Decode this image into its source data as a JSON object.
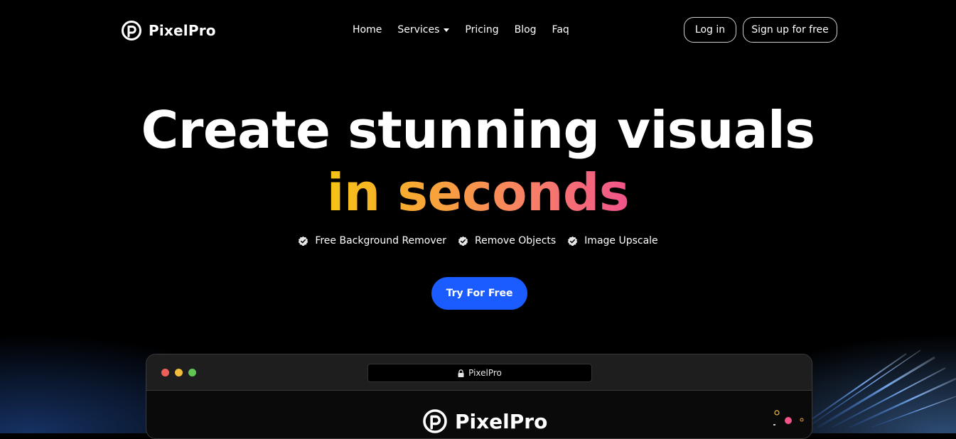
{
  "brand": {
    "name": "PixelPro",
    "logo_icon": "pixelpro-logo-icon"
  },
  "nav": {
    "items": [
      {
        "label": "Home"
      },
      {
        "label": "Services",
        "has_dropdown": true
      },
      {
        "label": "Pricing"
      },
      {
        "label": "Blog"
      },
      {
        "label": "Faq"
      }
    ]
  },
  "auth": {
    "login_label": "Log in",
    "signup_label": "Sign up for free"
  },
  "hero": {
    "title_line1": "Create stunning visuals",
    "title_line2": "in seconds",
    "features": [
      {
        "label": "Free Background Remover",
        "icon": "check-badge-icon"
      },
      {
        "label": "Remove Objects",
        "icon": "check-badge-icon"
      },
      {
        "label": "Image Upscale",
        "icon": "check-badge-icon"
      }
    ],
    "cta_label": "Try For Free"
  },
  "preview": {
    "address_text": "PixelPro",
    "address_icon": "lock-icon",
    "inner_brand": "PixelPro"
  },
  "colors": {
    "background": "#000000",
    "cta": "#1a5cff",
    "gradient_start": "#f7c315",
    "gradient_end": "#f0548b"
  }
}
